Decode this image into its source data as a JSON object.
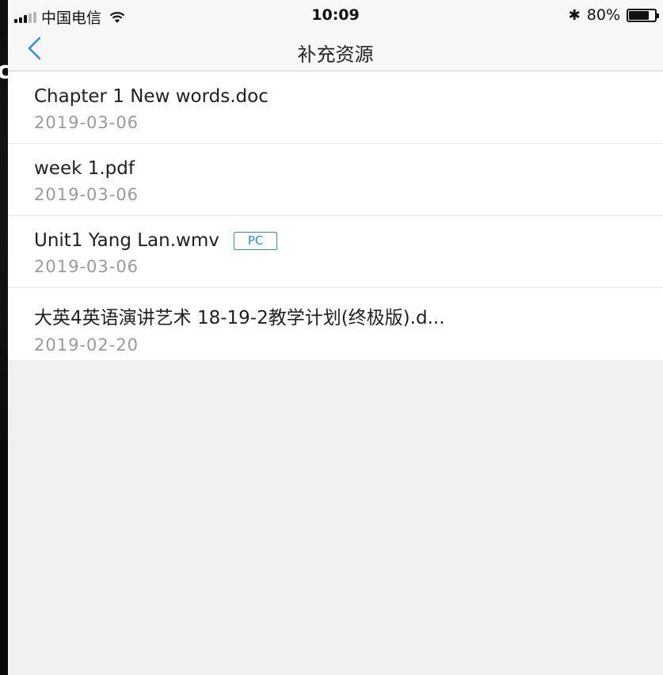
{
  "status_bar": {
    "carrier": "中国电信",
    "time": "10:09",
    "battery": "80%",
    "battery_level": 0.8,
    "icons": [
      "signal-icon",
      "wifi-icon",
      "bluetooth-icon",
      "battery-icon"
    ]
  },
  "overlay_text": "c",
  "nav": {
    "title": "补充资源",
    "back_icon": "chevron-left-icon",
    "accent_color": "#2a8cf0"
  },
  "files": [
    {
      "name": "Chapter 1 New words.doc",
      "date": "2019-03-06",
      "badge": ""
    },
    {
      "name": "week 1.pdf",
      "date": "2019-03-06",
      "badge": ""
    },
    {
      "name": "Unit1 Yang Lan.wmv",
      "date": "2019-03-06",
      "badge": "PC"
    },
    {
      "name": "大英4英语演讲艺术 18-19-2教学计划(终极版).d...",
      "date": "2019-02-20",
      "badge": ""
    }
  ]
}
